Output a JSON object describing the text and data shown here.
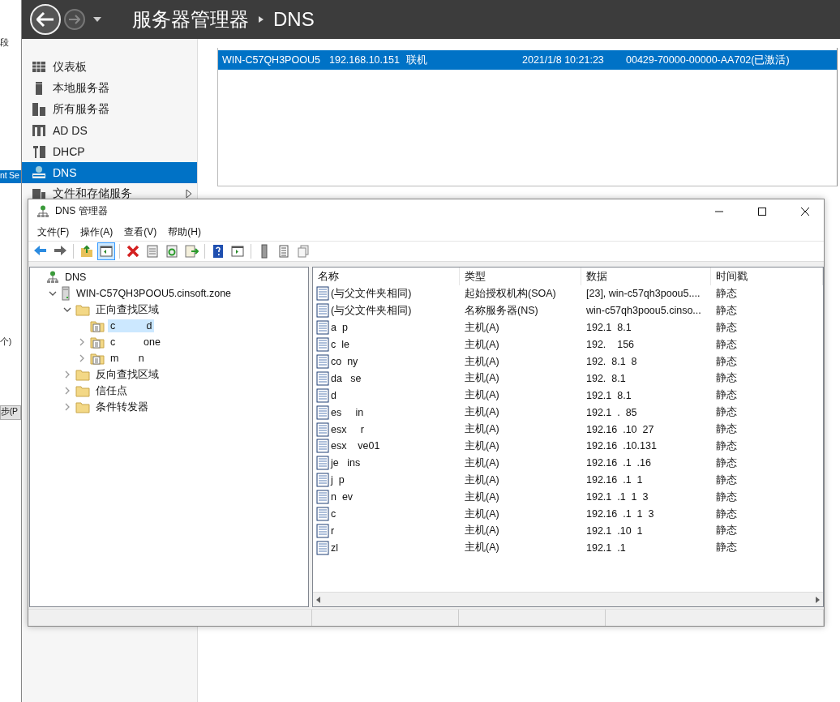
{
  "background_window": {
    "texts": [
      "段",
      "nt Se",
      "个)",
      "步(P"
    ]
  },
  "header": {
    "title": "服务器管理器",
    "section": "DNS"
  },
  "sidebar": {
    "items": [
      {
        "label": "仪表板",
        "kind": "dashboard",
        "selected": false
      },
      {
        "label": "本地服务器",
        "kind": "server",
        "selected": false
      },
      {
        "label": "所有服务器",
        "kind": "servers",
        "selected": false
      },
      {
        "label": "AD DS",
        "kind": "adds",
        "selected": false
      },
      {
        "label": "DHCP",
        "kind": "dhcp",
        "selected": false
      },
      {
        "label": "DNS",
        "kind": "dns",
        "selected": true
      },
      {
        "label": "文件和存储服务",
        "kind": "storage",
        "selected": false,
        "submenu": true
      }
    ]
  },
  "servers": {
    "rows": [
      {
        "selected": true,
        "cells": [
          "WIN-C57QH3POOU5",
          "192.168.10.151",
          "联机",
          "2021/1/8 10:21:23",
          "00429-70000-00000-AA702(已激活)"
        ]
      }
    ]
  },
  "dns_manager": {
    "title": "DNS 管理器",
    "menu": [
      "文件(F)",
      "操作(A)",
      "查看(V)",
      "帮助(H)"
    ],
    "toolbar": [
      {
        "kind": "back",
        "pressed": false
      },
      {
        "kind": "forward",
        "pressed": false
      },
      {
        "kind": "separator"
      },
      {
        "kind": "up",
        "pressed": false
      },
      {
        "kind": "tree",
        "pressed": true
      },
      {
        "kind": "separator"
      },
      {
        "kind": "delete",
        "pressed": false
      },
      {
        "kind": "properties",
        "pressed": false
      },
      {
        "kind": "refresh",
        "pressed": false
      },
      {
        "kind": "export",
        "pressed": false
      },
      {
        "kind": "separator"
      },
      {
        "kind": "help",
        "pressed": false
      },
      {
        "kind": "console",
        "pressed": false
      },
      {
        "kind": "separator"
      },
      {
        "kind": "server",
        "pressed": false
      },
      {
        "kind": "list",
        "pressed": false
      },
      {
        "kind": "copy",
        "pressed": false
      }
    ],
    "tree": [
      {
        "label": "DNS",
        "kind": "dns",
        "selected": false,
        "children": [
          {
            "label": "WIN-C57QH3POOU5.cinsoft.zone",
            "kind": "server",
            "expanded": true,
            "selected": false,
            "children": [
              {
                "label": "正向查找区域",
                "kind": "folder",
                "expanded": true,
                "selected": false,
                "children": [
                  {
                    "label": "c           d",
                    "kind": "zone",
                    "selected": true
                  },
                  {
                    "label": "c          one",
                    "kind": "zone",
                    "expanded": false,
                    "selected": false
                  },
                  {
                    "label": "m       n",
                    "kind": "zone",
                    "expanded": false,
                    "selected": false
                  }
                ]
              },
              {
                "label": "反向查找区域",
                "kind": "folder",
                "expanded": false,
                "selected": false
              },
              {
                "label": "信任点",
                "kind": "folder",
                "expanded": false,
                "selected": false
              },
              {
                "label": "条件转发器",
                "kind": "folder",
                "expanded": false,
                "selected": false
              }
            ]
          }
        ]
      }
    ],
    "columns": [
      "名称",
      "类型",
      "数据",
      "时间戳"
    ],
    "records": [
      [
        "(与父文件夹相同)",
        "起始授权机构(SOA)",
        "[23], win-c57qh3poou5....",
        "静态"
      ],
      [
        "(与父文件夹相同)",
        "名称服务器(NS)",
        "win-c57qh3poou5.cinso...",
        "静态"
      ],
      [
        "a  p",
        "主机(A)",
        "192.1  8.1",
        "静态"
      ],
      [
        "c  le",
        "主机(A)",
        "192.    156",
        "静态"
      ],
      [
        "co  ny",
        "主机(A)",
        "192.  8.1  8",
        "静态"
      ],
      [
        "da   se",
        "主机(A)",
        "192.  8.1",
        "静态"
      ],
      [
        "d",
        "主机(A)",
        "192.1  8.1",
        "静态"
      ],
      [
        "es     in",
        "主机(A)",
        "192.1  .  85",
        "静态"
      ],
      [
        "esx     r",
        "主机(A)",
        "192.16  .10  27",
        "静态"
      ],
      [
        "esx    ve01",
        "主机(A)",
        "192.16  .10.131",
        "静态"
      ],
      [
        "je   ins",
        "主机(A)",
        "192.16  .1  .16",
        "静态"
      ],
      [
        "j  p",
        "主机(A)",
        "192.16  .1  1",
        "静态"
      ],
      [
        "n  ev",
        "主机(A)",
        "192.1  .1  1  3",
        "静态"
      ],
      [
        "c",
        "主机(A)",
        "192.16  .1  1  3",
        "静态"
      ],
      [
        "r",
        "主机(A)",
        "192.1  .10  1",
        "静态"
      ],
      [
        "zl",
        "主机(A)",
        "192.1  .1",
        "静态"
      ]
    ]
  }
}
